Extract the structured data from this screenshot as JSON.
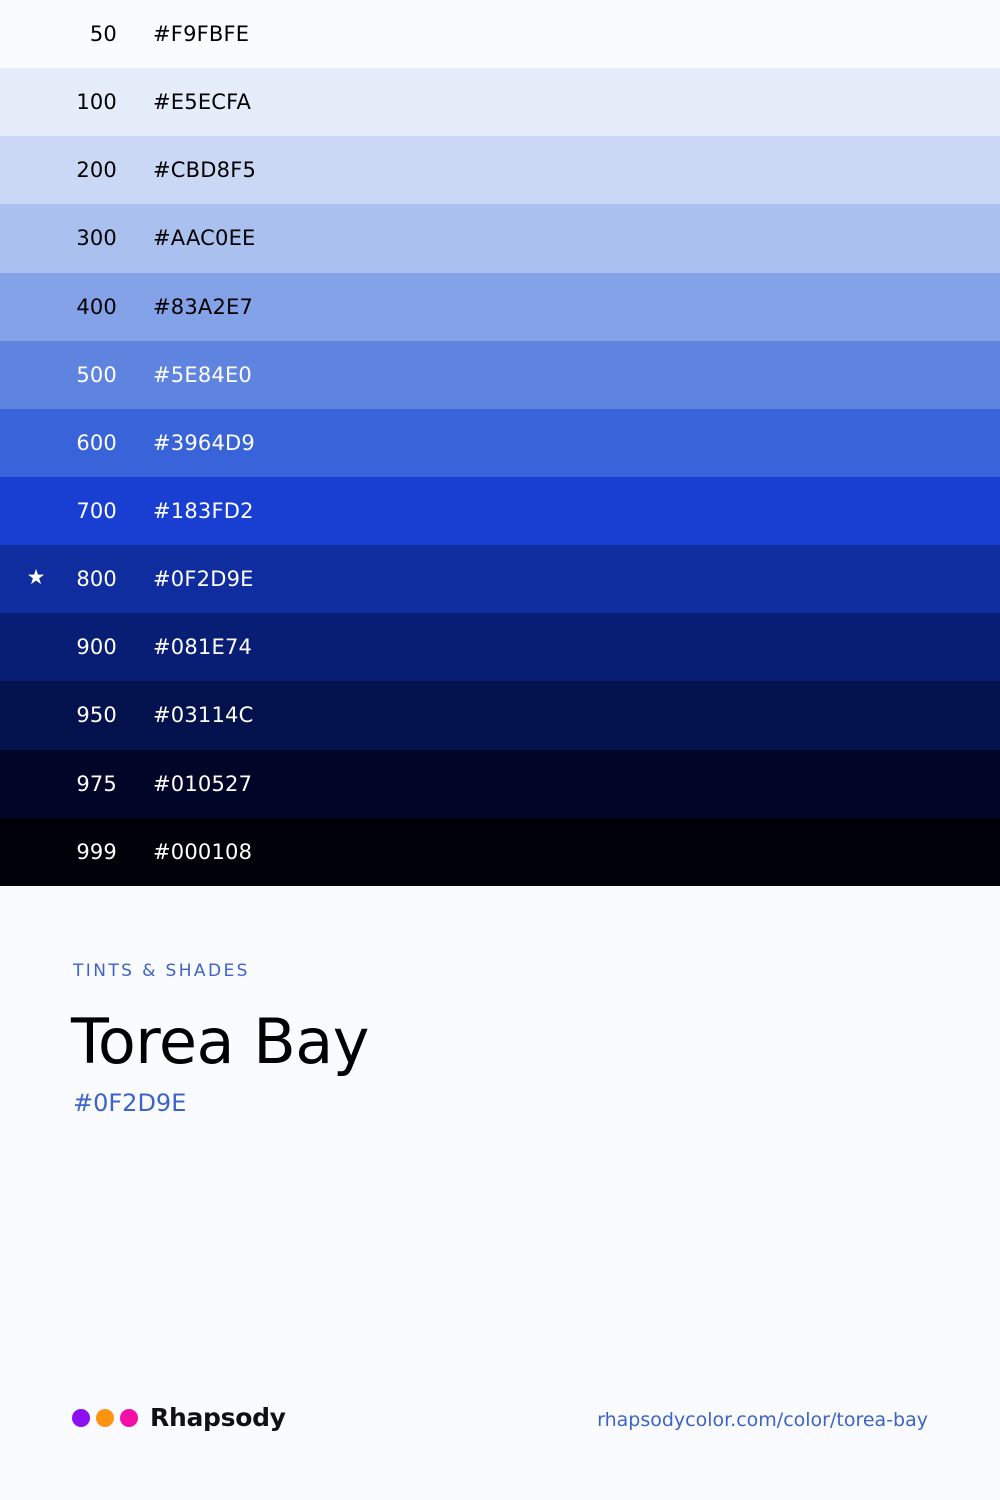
{
  "swatches": [
    {
      "step": "50",
      "hex": "#F9FBFE",
      "bg": "#F9FBFE",
      "fg": "#000000",
      "star": ""
    },
    {
      "step": "100",
      "hex": "#E5ECFA",
      "bg": "#E5ECFA",
      "fg": "#000000",
      "star": ""
    },
    {
      "step": "200",
      "hex": "#CBD8F5",
      "bg": "#CBD8F5",
      "fg": "#000000",
      "star": ""
    },
    {
      "step": "300",
      "hex": "#AAC0EE",
      "bg": "#AAC0EE",
      "fg": "#000000",
      "star": ""
    },
    {
      "step": "400",
      "hex": "#83A2E7",
      "bg": "#83A2E7",
      "fg": "#000000",
      "star": ""
    },
    {
      "step": "500",
      "hex": "#5E84E0",
      "bg": "#5E84E0",
      "fg": "#FFFFFF",
      "star": ""
    },
    {
      "step": "600",
      "hex": "#3964D9",
      "bg": "#3964D9",
      "fg": "#FFFFFF",
      "star": ""
    },
    {
      "step": "700",
      "hex": "#183FD2",
      "bg": "#183FD2",
      "fg": "#FFFFFF",
      "star": ""
    },
    {
      "step": "800",
      "hex": "#0F2D9E",
      "bg": "#0F2D9E",
      "fg": "#FFFFFF",
      "star": "★"
    },
    {
      "step": "900",
      "hex": "#081E74",
      "bg": "#081E74",
      "fg": "#FFFFFF",
      "star": ""
    },
    {
      "step": "950",
      "hex": "#03114C",
      "bg": "#03114C",
      "fg": "#FFFFFF",
      "star": ""
    },
    {
      "step": "975",
      "hex": "#010527",
      "bg": "#010527",
      "fg": "#FFFFFF",
      "star": ""
    },
    {
      "step": "999",
      "hex": "#000108",
      "bg": "#000108",
      "fg": "#FFFFFF",
      "star": ""
    }
  ],
  "info": {
    "eyebrow": "TINTS & SHADES",
    "title": "Torea Bay",
    "subtitle": "#0F2D9E"
  },
  "footer": {
    "brand_name": "Rhapsody",
    "brand_dots": [
      "#8B0FF0",
      "#FF9410",
      "#F50FA8"
    ],
    "url": "rhapsodycolor.com/color/torea-bay"
  },
  "colors": {
    "page_bg": "#F9FBFE",
    "accent": "#3D63C9"
  }
}
